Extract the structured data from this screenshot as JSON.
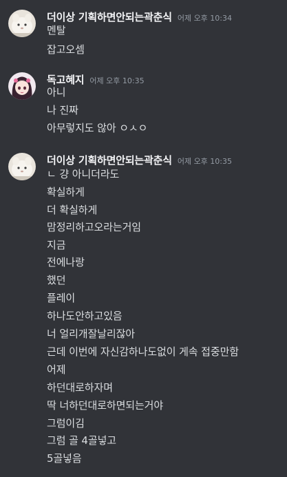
{
  "messages": [
    {
      "username": "더이상 기획하면안되는곽춘식",
      "timestamp": "어제 오후 10:34",
      "avatar_icon": "plush-avatar",
      "lines": [
        "멘탈",
        "잡고오셈"
      ]
    },
    {
      "username": "독고혜지",
      "timestamp": "어제 오후 10:35",
      "avatar_icon": "anime-girl-avatar",
      "lines": [
        "아니",
        "나 진짜",
        "아무렇지도 않아 ㅇㅅㅇ"
      ]
    },
    {
      "username": "더이상 기획하면안되는곽춘식",
      "timestamp": "어제 오후 10:35",
      "avatar_icon": "plush-avatar",
      "lines": [
        "ㄴ 걍 아니더라도",
        "확실하게",
        "더 확실하게",
        "맘정리하고오라는거임",
        "지금",
        "전에나랑",
        "했던",
        "플레이",
        "하나도안하고있음",
        "너 얼리개잘날리잖아",
        "근데 이번에 자신감하나도없이 게속 접중만함",
        "어제",
        "하던대로하자며",
        "딱 너하던대로하면되는거야",
        "그럼이김",
        "그럼 골 4골넣고",
        "5골넣음"
      ]
    }
  ],
  "colors": {
    "background": "#313338",
    "username": "#f2f3f5",
    "text": "#dbdee1",
    "timestamp": "#949ba4"
  }
}
